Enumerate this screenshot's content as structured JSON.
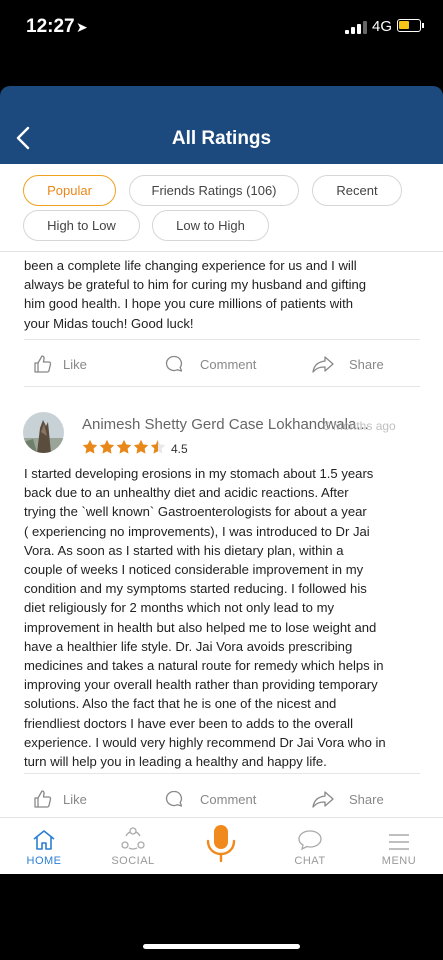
{
  "status_bar": {
    "time": "12:27",
    "network": "4G",
    "signal_bars": 3,
    "battery_level": 0.4,
    "battery_color": "#f5c518"
  },
  "header": {
    "back_icon": "chevron-left-icon",
    "title": "All Ratings",
    "background": "#1d4a7e"
  },
  "filters": [
    {
      "label": "Popular",
      "active": true
    },
    {
      "label": "Friends Ratings (106)",
      "active": false
    },
    {
      "label": "Recent",
      "active": false
    },
    {
      "label": "High to Low",
      "active": false
    },
    {
      "label": "Low to High",
      "active": false
    }
  ],
  "reviews": [
    {
      "lines": [
        "been a complete life changing experience for us and I will",
        "always be grateful to him for curing my husband and gifting",
        "him good health.  I hope you cure millions of patients with",
        "your Midas touch! Good luck!"
      ],
      "actions": {
        "like": "Like",
        "comment": "Comment",
        "share": "Share"
      }
    },
    {
      "reviewer": "Animesh Shetty Gerd Case Lokhandwala...",
      "time": "6 Months ago",
      "rating": 4.5,
      "rating_text": "4.5",
      "lines": [
        "I started developing erosions in my stomach about 1.5 years",
        "back due to an unhealthy diet and acidic reactions. After",
        "trying the `well known` Gastroenterologists for about a year",
        "( experiencing no improvements), I was introduced to Dr Jai",
        "Vora. As soon as I started with his dietary plan, within a",
        "couple of weeks I noticed considerable improvement in my",
        "condition and my symptoms started reducing. I followed his",
        "diet religiously for 2 months which not only lead to my",
        "improvement in health but also helped me to lose weight and",
        "have a healthier life style. Dr. Jai Vora avoids prescribing",
        "medicines and takes a natural route for remedy which helps in",
        "improving your overall health rather than providing temporary",
        "solutions. Also the fact that he is one of the nicest and",
        "friendliest doctors I have ever been to adds to the overall",
        "experience. I would very highly recommend Dr Jai Vora who in",
        "turn will help you in leading a healthy and happy life."
      ],
      "actions": {
        "like": "Like",
        "comment": "Comment",
        "share": "Share"
      }
    }
  ],
  "bottom_nav": [
    {
      "label": "HOME",
      "icon": "home-icon",
      "active": true
    },
    {
      "label": "SOCIAL",
      "icon": "social-icon",
      "active": false
    },
    {
      "label": "",
      "icon": "microphone-icon",
      "active": false
    },
    {
      "label": "CHAT",
      "icon": "chat-icon",
      "active": false
    },
    {
      "label": "MENU",
      "icon": "menu-icon",
      "active": false
    }
  ],
  "colors": {
    "accent_orange": "#f0a21f",
    "star_color": "#e8881a",
    "active_nav": "#2a7fd4"
  }
}
